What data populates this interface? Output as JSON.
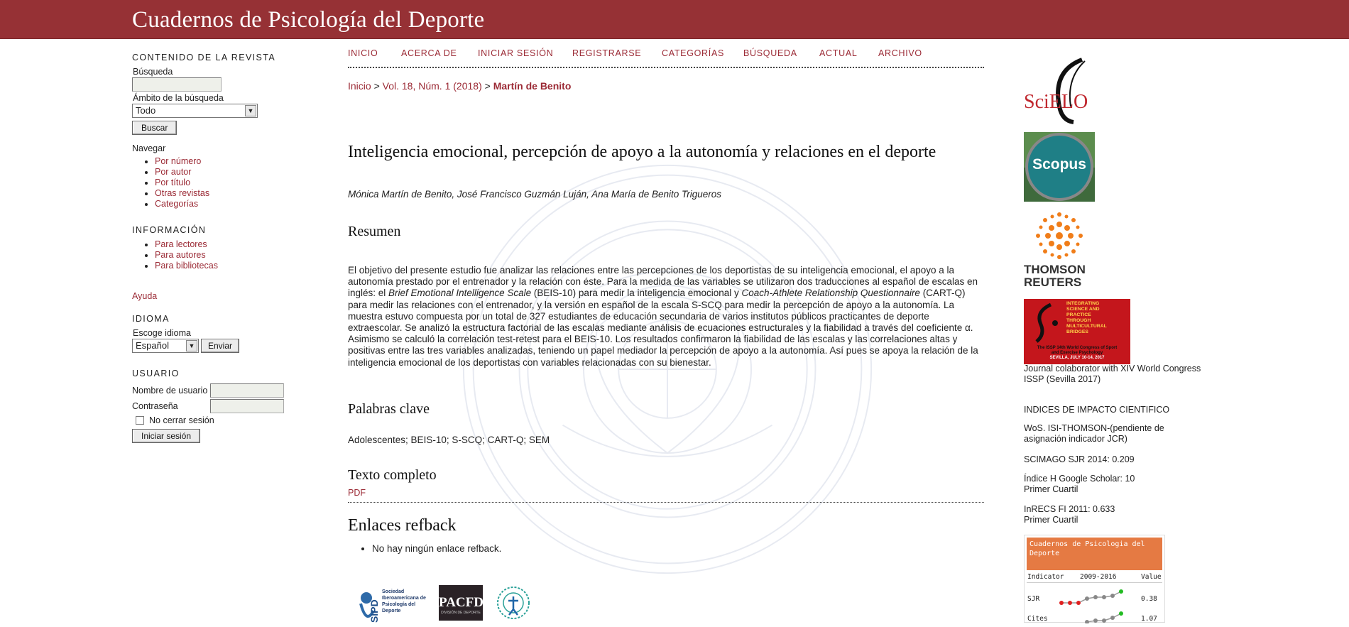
{
  "header": {
    "site_title": "Cuadernos de Psicología del Deporte"
  },
  "left_sidebar": {
    "journal_content": {
      "title": "CONTENIDO DE LA REVISTA",
      "search_label": "Búsqueda",
      "scope_label": "Ámbito de la búsqueda",
      "scope_value": "Todo",
      "search_button": "Buscar",
      "browse_label": "Navegar",
      "browse_items": [
        "Por número",
        "Por autor",
        "Por título",
        "Otras revistas",
        "Categorías"
      ]
    },
    "information": {
      "title": "INFORMACIÓN",
      "items": [
        "Para lectores",
        "Para autores",
        "Para bibliotecas"
      ]
    },
    "help_link": "Ayuda",
    "language": {
      "title": "IDIOMA",
      "label": "Escoge idioma",
      "value": "Español",
      "button": "Enviar"
    },
    "user": {
      "title": "USUARIO",
      "username_label": "Nombre de usuario",
      "password_label": "Contraseña",
      "remember_label": "No cerrar sesión",
      "login_button": "Iniciar sesión"
    }
  },
  "navbar": {
    "items": [
      "INICIO",
      "ACERCA DE",
      "INICIAR SESIÓN",
      "REGISTRARSE",
      "CATEGORÍAS",
      "BÚSQUEDA",
      "ACTUAL",
      "ARCHIVO"
    ]
  },
  "breadcrumb": {
    "home": "Inicio",
    "separator": ">",
    "issue": "Vol. 18, Núm. 1 (2018)",
    "current": "Martín de Benito"
  },
  "article": {
    "title": "Inteligencia emocional, percepción de apoyo a la autonomía y relaciones en el deporte",
    "authors": "Mónica Martín de Benito, José Francisco Guzmán Luján, Ana María de Benito Trigueros",
    "abstract_heading": "Resumen",
    "abstract_p1": "El objetivo del presente estudio fue analizar las relaciones entre las percepciones de los deportistas de su inteligencia emocional, el apoyo a la autonomía prestado por el entrenador y la relación con éste. Para la medida de las variables se utilizaron dos traducciones al español de escalas en inglés: el ",
    "abstract_em1": "Brief Emotional Intelligence Scale",
    "abstract_p2": " (BEIS-10) para medir la inteligencia emocional y ",
    "abstract_em2": "Coach-Athlete Relationship Questionnaire",
    "abstract_p3": " (CART-Q) para medir las relaciones con el entrenador, y la versión en español de la escala S-SCQ para medir la percepción de apoyo a la autonomía. La muestra estuvo compuesta por un total de 327 estudiantes de educación secundaria de varios institutos públicos practicantes de deporte extraescolar. Se analizó la estructura factorial de las escalas mediante análisis de ecuaciones estructurales y la fiabilidad a través del coeficiente α. Asimismo se calculó la correlación test-retest para el BEIS-10. Los resultados confirmaron la fiabilidad de las escalas y las correlaciones altas y positivas entre las tres variables analizadas, teniendo un papel mediador la percepción de apoyo a la autonomía. Así pues se apoya la relación de la inteligencia emocional de los deportistas con variables relacionadas con su bienestar.",
    "keywords_heading": "Palabras clave",
    "keywords": "Adolescentes; BEIS-10; S-SCQ; CART-Q; SEM",
    "fulltext_heading": "Texto completo",
    "pdf_link": "PDF",
    "refback_heading": "Enlaces refback",
    "refback_item": "No hay ningún enlace refback."
  },
  "sponsor_logos": {
    "sipd_text": [
      "Sociedad",
      "Iberoamericana de",
      "Psicología del",
      "Deporte"
    ],
    "sipd_mark": "SIPD",
    "paced_text": "PACFD",
    "paced_sub": "DIVISIÓN DE DEPORTE"
  },
  "right_sidebar": {
    "scielo_logo": "SciELO",
    "scopus_logo": "Scopus",
    "thomson_logo": [
      "THOMSON",
      "REUTERS"
    ],
    "issp_banner": [
      "INTEGRATING",
      "SCIENCE AND",
      "PRACTICE",
      "THROUGH",
      "MULTICULTURAL",
      "BRIDGES"
    ],
    "issp_footer": [
      "The ISSP 14th World Congress of Sport",
      "and Exercise Psychology",
      "SEVILLA, JULY 10-14, 2017"
    ],
    "issp_caption": "Journal colaborator with XIV World Congress ISSP (Sevilla 2017)",
    "impact_title": "INDICES DE IMPACTO CIENTIFICO",
    "wos": "WoS. ISI-THOMSON-(pendiente de asignación indicador JCR)",
    "scimago_sjr": "SCIMAGO SJR 2014: 0.209",
    "google_scholar": "Índice H Google Scholar: 10",
    "google_quartile": "Primer Cuartil",
    "inrecs": "InRECS FI 2011: 0.633",
    "inrecs_quartile": "Primer Cuartil",
    "scimago_widget": {
      "title": "Cuadernos de Psicologia del Deporte",
      "col_indicator": "Indicator",
      "col_range": "2009-2016",
      "col_value": "Value",
      "row1_label": "SJR",
      "row1_value": "0.38",
      "row2_label": "Cites",
      "row2_value": "1.07"
    }
  },
  "colors": {
    "header_bg": "#963135",
    "link": "#9b2a35",
    "scimago_orange": "#e57a43"
  }
}
